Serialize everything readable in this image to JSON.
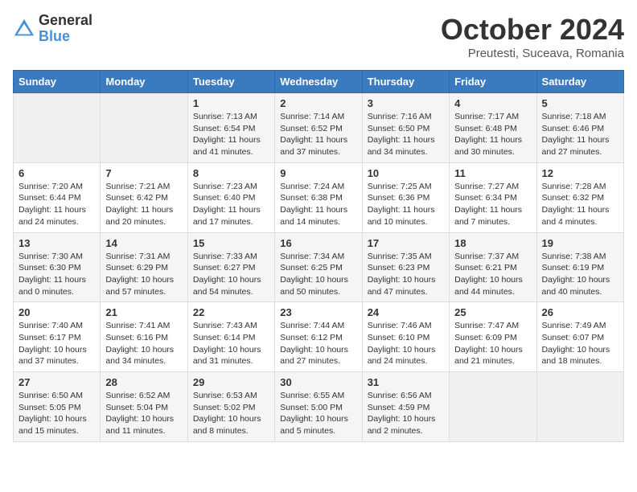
{
  "header": {
    "logo_general": "General",
    "logo_blue": "Blue",
    "month": "October 2024",
    "location": "Preutesti, Suceava, Romania"
  },
  "days_of_week": [
    "Sunday",
    "Monday",
    "Tuesday",
    "Wednesday",
    "Thursday",
    "Friday",
    "Saturday"
  ],
  "weeks": [
    [
      {
        "day": "",
        "content": ""
      },
      {
        "day": "",
        "content": ""
      },
      {
        "day": "1",
        "content": "Sunrise: 7:13 AM\nSunset: 6:54 PM\nDaylight: 11 hours and 41 minutes."
      },
      {
        "day": "2",
        "content": "Sunrise: 7:14 AM\nSunset: 6:52 PM\nDaylight: 11 hours and 37 minutes."
      },
      {
        "day": "3",
        "content": "Sunrise: 7:16 AM\nSunset: 6:50 PM\nDaylight: 11 hours and 34 minutes."
      },
      {
        "day": "4",
        "content": "Sunrise: 7:17 AM\nSunset: 6:48 PM\nDaylight: 11 hours and 30 minutes."
      },
      {
        "day": "5",
        "content": "Sunrise: 7:18 AM\nSunset: 6:46 PM\nDaylight: 11 hours and 27 minutes."
      }
    ],
    [
      {
        "day": "6",
        "content": "Sunrise: 7:20 AM\nSunset: 6:44 PM\nDaylight: 11 hours and 24 minutes."
      },
      {
        "day": "7",
        "content": "Sunrise: 7:21 AM\nSunset: 6:42 PM\nDaylight: 11 hours and 20 minutes."
      },
      {
        "day": "8",
        "content": "Sunrise: 7:23 AM\nSunset: 6:40 PM\nDaylight: 11 hours and 17 minutes."
      },
      {
        "day": "9",
        "content": "Sunrise: 7:24 AM\nSunset: 6:38 PM\nDaylight: 11 hours and 14 minutes."
      },
      {
        "day": "10",
        "content": "Sunrise: 7:25 AM\nSunset: 6:36 PM\nDaylight: 11 hours and 10 minutes."
      },
      {
        "day": "11",
        "content": "Sunrise: 7:27 AM\nSunset: 6:34 PM\nDaylight: 11 hours and 7 minutes."
      },
      {
        "day": "12",
        "content": "Sunrise: 7:28 AM\nSunset: 6:32 PM\nDaylight: 11 hours and 4 minutes."
      }
    ],
    [
      {
        "day": "13",
        "content": "Sunrise: 7:30 AM\nSunset: 6:30 PM\nDaylight: 11 hours and 0 minutes."
      },
      {
        "day": "14",
        "content": "Sunrise: 7:31 AM\nSunset: 6:29 PM\nDaylight: 10 hours and 57 minutes."
      },
      {
        "day": "15",
        "content": "Sunrise: 7:33 AM\nSunset: 6:27 PM\nDaylight: 10 hours and 54 minutes."
      },
      {
        "day": "16",
        "content": "Sunrise: 7:34 AM\nSunset: 6:25 PM\nDaylight: 10 hours and 50 minutes."
      },
      {
        "day": "17",
        "content": "Sunrise: 7:35 AM\nSunset: 6:23 PM\nDaylight: 10 hours and 47 minutes."
      },
      {
        "day": "18",
        "content": "Sunrise: 7:37 AM\nSunset: 6:21 PM\nDaylight: 10 hours and 44 minutes."
      },
      {
        "day": "19",
        "content": "Sunrise: 7:38 AM\nSunset: 6:19 PM\nDaylight: 10 hours and 40 minutes."
      }
    ],
    [
      {
        "day": "20",
        "content": "Sunrise: 7:40 AM\nSunset: 6:17 PM\nDaylight: 10 hours and 37 minutes."
      },
      {
        "day": "21",
        "content": "Sunrise: 7:41 AM\nSunset: 6:16 PM\nDaylight: 10 hours and 34 minutes."
      },
      {
        "day": "22",
        "content": "Sunrise: 7:43 AM\nSunset: 6:14 PM\nDaylight: 10 hours and 31 minutes."
      },
      {
        "day": "23",
        "content": "Sunrise: 7:44 AM\nSunset: 6:12 PM\nDaylight: 10 hours and 27 minutes."
      },
      {
        "day": "24",
        "content": "Sunrise: 7:46 AM\nSunset: 6:10 PM\nDaylight: 10 hours and 24 minutes."
      },
      {
        "day": "25",
        "content": "Sunrise: 7:47 AM\nSunset: 6:09 PM\nDaylight: 10 hours and 21 minutes."
      },
      {
        "day": "26",
        "content": "Sunrise: 7:49 AM\nSunset: 6:07 PM\nDaylight: 10 hours and 18 minutes."
      }
    ],
    [
      {
        "day": "27",
        "content": "Sunrise: 6:50 AM\nSunset: 5:05 PM\nDaylight: 10 hours and 15 minutes."
      },
      {
        "day": "28",
        "content": "Sunrise: 6:52 AM\nSunset: 5:04 PM\nDaylight: 10 hours and 11 minutes."
      },
      {
        "day": "29",
        "content": "Sunrise: 6:53 AM\nSunset: 5:02 PM\nDaylight: 10 hours and 8 minutes."
      },
      {
        "day": "30",
        "content": "Sunrise: 6:55 AM\nSunset: 5:00 PM\nDaylight: 10 hours and 5 minutes."
      },
      {
        "day": "31",
        "content": "Sunrise: 6:56 AM\nSunset: 4:59 PM\nDaylight: 10 hours and 2 minutes."
      },
      {
        "day": "",
        "content": ""
      },
      {
        "day": "",
        "content": ""
      }
    ]
  ]
}
